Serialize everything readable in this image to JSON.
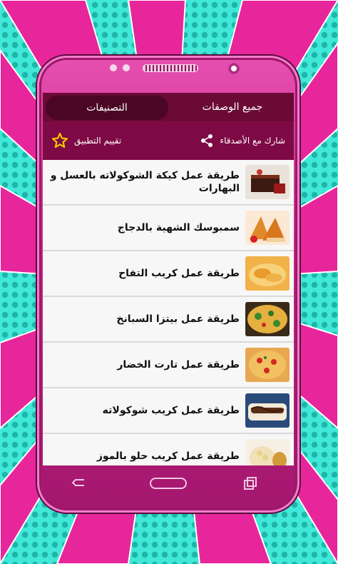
{
  "tabs": [
    {
      "label": "جميع الوصفات"
    },
    {
      "label": "التصنيفات",
      "active": true
    }
  ],
  "actions": {
    "share_label": "شارك مع الأصدقاء",
    "rate_label": "تقييم التطبيق"
  },
  "recipes": [
    {
      "title": "طريقة عمل كيكة الشوكولاته بالعسل و البهارات",
      "thumb": "chocolate-cake"
    },
    {
      "title": "سمبوسك الشهية  بالدجاج",
      "thumb": "samosa"
    },
    {
      "title": "طريقة عمل كريب التفاح",
      "thumb": "apple-crepe"
    },
    {
      "title": "طريقة عمل بيتزا السبانخ",
      "thumb": "spinach-pizza"
    },
    {
      "title": "طريقة عمل تارت الخضار",
      "thumb": "veg-tart"
    },
    {
      "title": "طريقة عمل كريب شوكولاته",
      "thumb": "chocolate-crepe"
    },
    {
      "title": "طريقة عمل كريب حلو بالموز",
      "thumb": "banana-crepe"
    }
  ],
  "colors": {
    "tab_bar": "#6a0a35",
    "action_bar": "#7e0a45",
    "phone_body": "#c42487",
    "star": "#f5c400"
  }
}
